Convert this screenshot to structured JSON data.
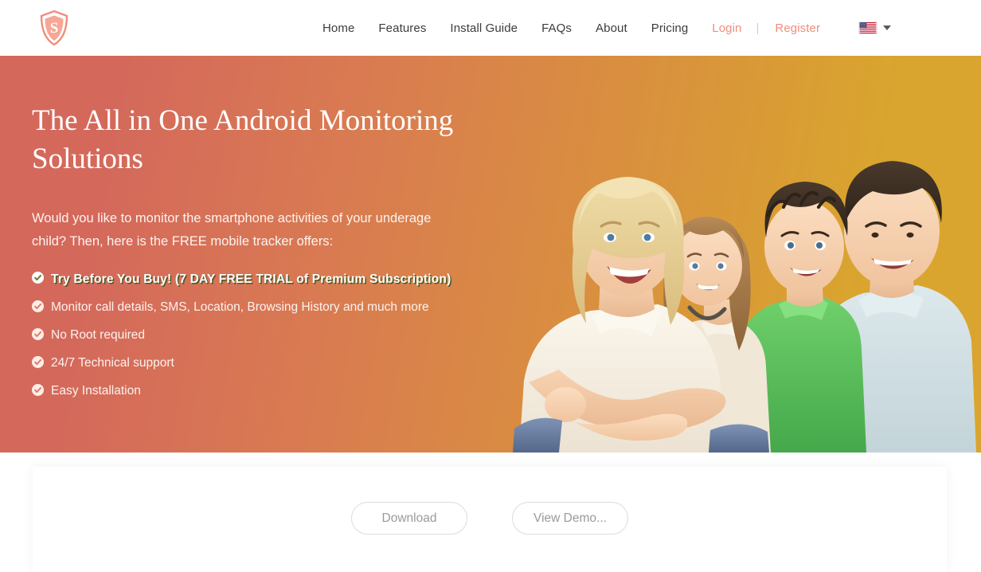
{
  "header": {
    "logo": {
      "icon": "shield-s-logo",
      "letter": "S",
      "color": "#ef8e7c"
    },
    "nav_items": [
      {
        "label": "Home",
        "accent": false
      },
      {
        "label": "Features",
        "accent": false
      },
      {
        "label": "Install Guide",
        "accent": false
      },
      {
        "label": "FAQs",
        "accent": false
      },
      {
        "label": "About",
        "accent": false
      },
      {
        "label": "Pricing",
        "accent": false
      }
    ],
    "login_label": "Login",
    "separator": "|",
    "register_label": "Register",
    "language": {
      "flag": "us-flag-icon",
      "caret": "chevron-down-icon"
    }
  },
  "hero": {
    "title": "The All in One Android Monitoring Solutions",
    "subtitle": "Would you like to monitor the smartphone activities of your underage child? Then, here is the FREE mobile tracker offers:",
    "bullets": [
      {
        "text": "Try Before You Buy! (7 DAY FREE TRIAL of Premium Subscription)",
        "emphasis": true
      },
      {
        "text": "Monitor call details, SMS, Location, Browsing History and much more",
        "emphasis": false
      },
      {
        "text": "No Root required",
        "emphasis": false
      },
      {
        "text": "24/7 Technical support",
        "emphasis": false
      },
      {
        "text": "Easy Installation",
        "emphasis": false
      }
    ],
    "image_alt": "family-photo",
    "gradient_start": "#d4695b",
    "gradient_end": "#d9a52e"
  },
  "card": {
    "download_label": "Download",
    "demo_label": "View Demo..."
  }
}
